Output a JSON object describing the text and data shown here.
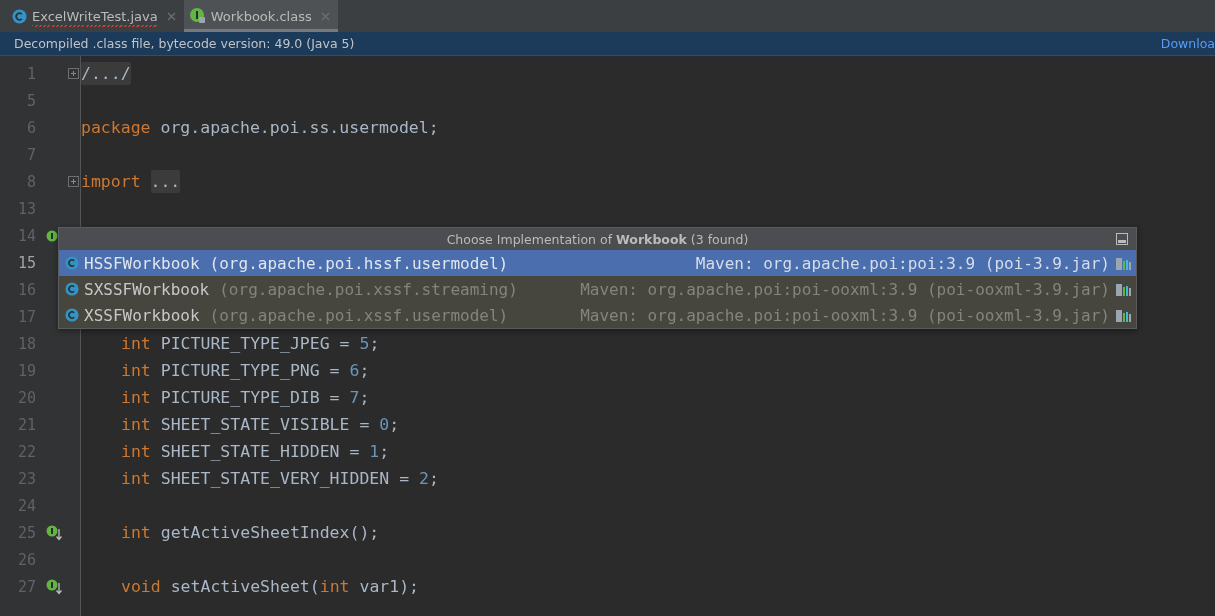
{
  "tabs": [
    {
      "label": "ExcelWriteTest.java",
      "kind": "class",
      "error": true,
      "selected": false
    },
    {
      "label": "Workbook.class",
      "kind": "interface",
      "error": false,
      "selected": true
    }
  ],
  "banner": {
    "text": "Decompiled .class file, bytecode version: 49.0 (Java 5)",
    "link": "Downloa"
  },
  "lines": [
    {
      "number": "1",
      "fold": true,
      "tokens": [
        {
          "kind": "folded",
          "text": "/.../"
        }
      ]
    },
    {
      "number": "5"
    },
    {
      "number": "6",
      "tokens": [
        {
          "kind": "keyword",
          "text": "package"
        },
        {
          "kind": "plain",
          "text": " org.apache.poi.ss.usermodel;"
        }
      ]
    },
    {
      "number": "7"
    },
    {
      "number": "8",
      "fold": true,
      "tokens": [
        {
          "kind": "keyword",
          "text": "import"
        },
        {
          "kind": "folded",
          "text": "..."
        }
      ]
    },
    {
      "number": "13"
    },
    {
      "number": "14",
      "kind": "implemented"
    },
    {
      "number": "15",
      "current": true
    },
    {
      "number": "16"
    },
    {
      "number": "17"
    },
    {
      "number": "18",
      "indented": true,
      "tokens": [
        {
          "kind": "keyword",
          "text": "int"
        },
        {
          "kind": "plain",
          "text": " PICTURE_TYPE_JPEG = "
        },
        {
          "kind": "number",
          "text": "5"
        },
        {
          "kind": "plain",
          "text": ";"
        }
      ]
    },
    {
      "number": "19",
      "indented": true,
      "tokens": [
        {
          "kind": "keyword",
          "text": "int"
        },
        {
          "kind": "plain",
          "text": " PICTURE_TYPE_PNG = "
        },
        {
          "kind": "number",
          "text": "6"
        },
        {
          "kind": "plain",
          "text": ";"
        }
      ]
    },
    {
      "number": "20",
      "indented": true,
      "tokens": [
        {
          "kind": "keyword",
          "text": "int"
        },
        {
          "kind": "plain",
          "text": " PICTURE_TYPE_DIB = "
        },
        {
          "kind": "number",
          "text": "7"
        },
        {
          "kind": "plain",
          "text": ";"
        }
      ]
    },
    {
      "number": "21",
      "indented": true,
      "tokens": [
        {
          "kind": "keyword",
          "text": "int"
        },
        {
          "kind": "plain",
          "text": " SHEET_STATE_VISIBLE = "
        },
        {
          "kind": "number",
          "text": "0"
        },
        {
          "kind": "plain",
          "text": ";"
        }
      ]
    },
    {
      "number": "22",
      "indented": true,
      "tokens": [
        {
          "kind": "keyword",
          "text": "int"
        },
        {
          "kind": "plain",
          "text": " SHEET_STATE_HIDDEN = "
        },
        {
          "kind": "number",
          "text": "1"
        },
        {
          "kind": "plain",
          "text": ";"
        }
      ]
    },
    {
      "number": "23",
      "indented": true,
      "tokens": [
        {
          "kind": "keyword",
          "text": "int"
        },
        {
          "kind": "plain",
          "text": " SHEET_STATE_VERY_HIDDEN = "
        },
        {
          "kind": "number",
          "text": "2"
        },
        {
          "kind": "plain",
          "text": ";"
        }
      ]
    },
    {
      "number": "24"
    },
    {
      "number": "25",
      "kind": "implemented-down",
      "indented": true,
      "tokens": [
        {
          "kind": "keyword",
          "text": "int"
        },
        {
          "kind": "plain",
          "text": " getActiveSheetIndex();"
        }
      ]
    },
    {
      "number": "26"
    },
    {
      "number": "27",
      "kind": "implemented-down",
      "indented": true,
      "tokens": [
        {
          "kind": "keyword",
          "text": "void"
        },
        {
          "kind": "plain",
          "text": " setActiveSheet("
        },
        {
          "kind": "keyword",
          "text": "int"
        },
        {
          "kind": "plain",
          "text": " var1);"
        }
      ]
    }
  ],
  "popup": {
    "title": "Choose Implementation of **Workbook** (3 found)",
    "items": [
      {
        "name": "HSSFWorkbook",
        "package": "(org.apache.poi.hssf.usermodel)",
        "location": "Maven: org.apache.poi:poi:3.9 (poi-3.9.jar)",
        "selected": true
      },
      {
        "name": "SXSSFWorkbook",
        "package": "(org.apache.poi.xssf.streaming)",
        "location": "Maven: org.apache.poi:poi-ooxml:3.9 (poi-ooxml-3.9.jar)",
        "selected": false
      },
      {
        "name": "XSSFWorkbook",
        "package": "(org.apache.poi.xssf.usermodel)",
        "location": "Maven: org.apache.poi:poi-ooxml:3.9 (poi-ooxml-3.9.jar)",
        "selected": false
      }
    ]
  }
}
